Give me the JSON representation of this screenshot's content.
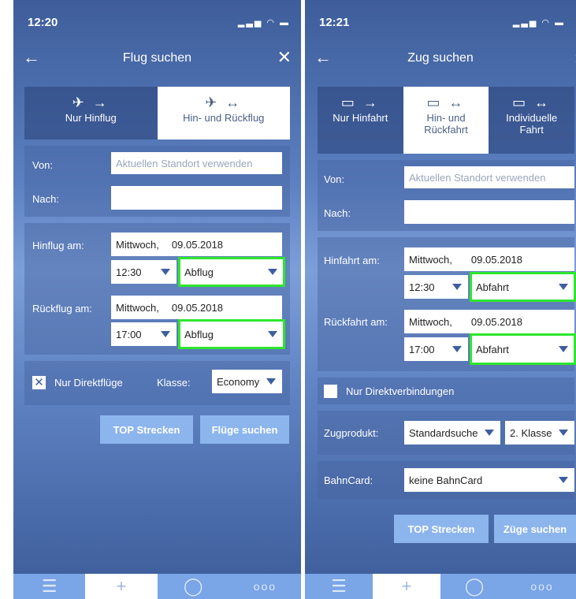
{
  "flight": {
    "time": "12:20",
    "title": "Flug suchen",
    "tabs": [
      "Nur Hinflug",
      "Hin- und Rückflug"
    ],
    "von_label": "Von:",
    "von_placeholder": "Aktuellen Standort verwenden",
    "nach_label": "Nach:",
    "hin_label": "Hinflug am:",
    "hin_day": "Mittwoch,",
    "hin_date": "09.05.2018",
    "hin_time": "12:30",
    "hin_mode": "Abflug",
    "rueck_label": "Rückflug am:",
    "rueck_day": "Mittwoch,",
    "rueck_date": "09.05.2018",
    "rueck_time": "17:00",
    "rueck_mode": "Abflug",
    "direct_label": "Nur Direktflüge",
    "klasse_label": "Klasse:",
    "klasse_value": "Economy",
    "top_button": "TOP Strecken",
    "search_button": "Flüge suchen"
  },
  "train": {
    "time": "12:21",
    "title": "Zug suchen",
    "tabs": [
      "Nur Hinfahrt",
      "Hin- und Rückfahrt",
      "Individuelle Fahrt"
    ],
    "von_label": "Von:",
    "von_placeholder": "Aktuellen Standort verwenden",
    "nach_label": "Nach:",
    "hin_label": "Hinfahrt am:",
    "hin_day": "Mittwoch,",
    "hin_date": "09.05.2018",
    "hin_time": "12:30",
    "hin_mode": "Abfahrt",
    "rueck_label": "Rückfahrt am:",
    "rueck_day": "Mittwoch,",
    "rueck_date": "09.05.2018",
    "rueck_time": "17:00",
    "rueck_mode": "Abfahrt",
    "direct_label": "Nur Direktverbindungen",
    "produkt_label": "Zugprodukt:",
    "produkt_value": "Standardsuche",
    "klasse_value": "2. Klasse",
    "bahncard_label": "BahnCard:",
    "bahncard_value": "keine BahnCard",
    "top_button": "TOP Strecken",
    "search_button": "Züge suchen"
  },
  "icons": {
    "back": "arrow-left-icon",
    "close": "close-icon",
    "plane": "airplane-icon",
    "train": "train-icon",
    "list": "list-icon",
    "plus": "plus-icon",
    "chat": "chat-bubble-icon",
    "more": "more-icon"
  },
  "colors": {
    "highlight": "#2ee62e",
    "button": "#8cb5ee",
    "background": "#4f72b3"
  }
}
